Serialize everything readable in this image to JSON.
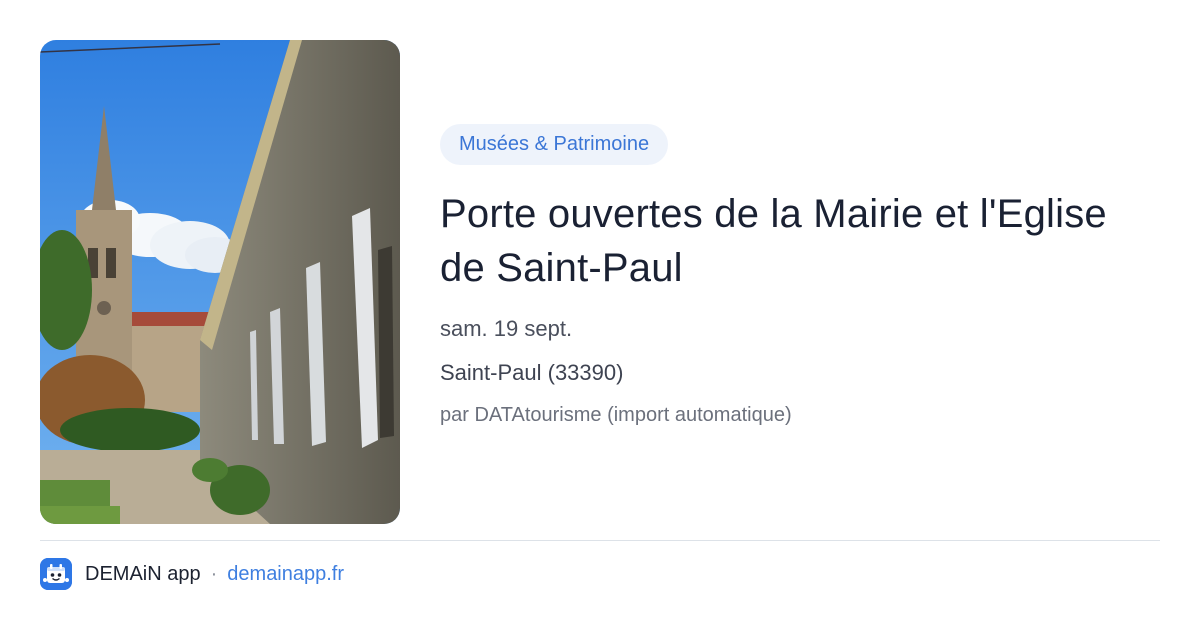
{
  "event": {
    "photo_description": "",
    "category": "Musées & Patrimoine",
    "title": "Porte ouvertes de la Mairie et l'Eglise de Saint-Paul",
    "date": "sam. 19 sept.",
    "location": "Saint-Paul (33390)",
    "source": "par DATAtourisme (import automatique)"
  },
  "footer": {
    "app_logo_icon": "demain-app-logo-icon",
    "app_name": "DEMAiN app",
    "separator": "·",
    "url": "demainapp.fr"
  },
  "colors": {
    "accent": "#3b76d6",
    "badge_bg": "#eef3fb",
    "title": "#1a2133",
    "link": "#3f7fe0"
  }
}
